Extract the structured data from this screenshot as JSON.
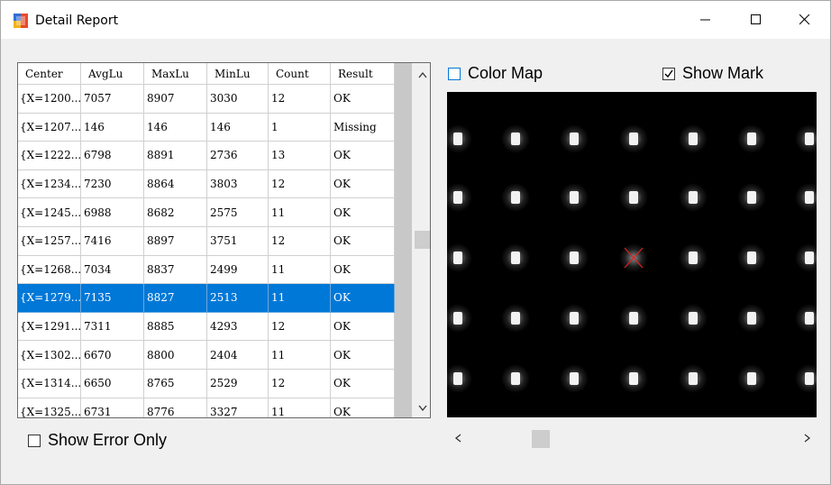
{
  "window": {
    "title": "Detail Report",
    "controls": {
      "minimize": "—",
      "maximize": "☐",
      "close": "✕"
    }
  },
  "table": {
    "columns": [
      "Center",
      "AvgLu",
      "MaxLu",
      "MinLu",
      "Count",
      "Result"
    ],
    "rows": [
      [
        "{X=1200...",
        "7057",
        "8907",
        "3030",
        "12",
        "OK"
      ],
      [
        "{X=1207...",
        "146",
        "146",
        "146",
        "1",
        "Missing"
      ],
      [
        "{X=1222...",
        "6798",
        "8891",
        "2736",
        "13",
        "OK"
      ],
      [
        "{X=1234...",
        "7230",
        "8864",
        "3803",
        "12",
        "OK"
      ],
      [
        "{X=1245...",
        "6988",
        "8682",
        "2575",
        "11",
        "OK"
      ],
      [
        "{X=1257...",
        "7416",
        "8897",
        "3751",
        "12",
        "OK"
      ],
      [
        "{X=1268...",
        "7034",
        "8837",
        "2499",
        "11",
        "OK"
      ],
      [
        "{X=1279...",
        "7135",
        "8827",
        "2513",
        "11",
        "OK"
      ],
      [
        "{X=1291...",
        "7311",
        "8885",
        "4293",
        "12",
        "OK"
      ],
      [
        "{X=1302...",
        "6670",
        "8800",
        "2404",
        "11",
        "OK"
      ],
      [
        "{X=1314...",
        "6650",
        "8765",
        "2529",
        "12",
        "OK"
      ],
      [
        "{X=1325...",
        "6731",
        "8776",
        "3327",
        "11",
        "OK"
      ]
    ],
    "selected_row_index": 7
  },
  "options": {
    "show_error_only": {
      "label": "Show Error Only",
      "checked": false
    },
    "color_map": {
      "label": "Color Map",
      "checked": false
    },
    "show_mark": {
      "label": "Show Mark",
      "checked": true
    }
  },
  "scroll_arrows": {
    "up": "^",
    "down": "v",
    "left": "<",
    "right": ">"
  },
  "colors": {
    "selection": "#0078d7",
    "mark": "#e02020"
  }
}
